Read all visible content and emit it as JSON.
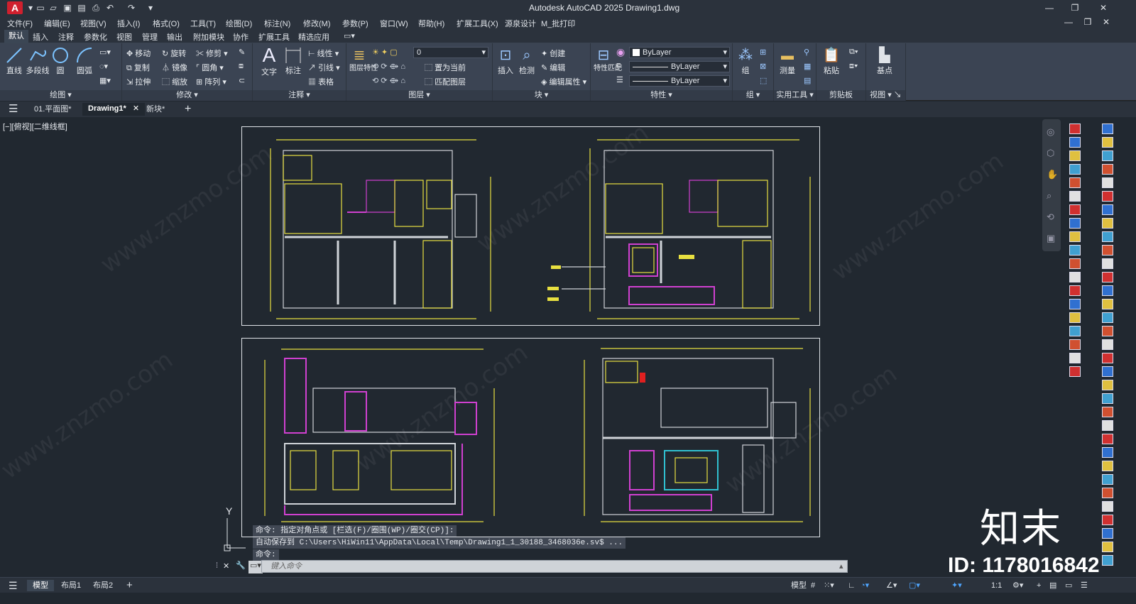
{
  "app": {
    "logo": "A",
    "title": "Autodesk AutoCAD 2025    Drawing1.dwg"
  },
  "menu": [
    "文件(F)",
    "编辑(E)",
    "视图(V)",
    "插入(I)",
    "格式(O)",
    "工具(T)",
    "绘图(D)",
    "标注(N)",
    "修改(M)",
    "参数(P)",
    "窗口(W)",
    "帮助(H)",
    "扩展工具(X)",
    "源泉设计",
    "M_批打印"
  ],
  "ribbon_tabs": [
    "默认",
    "插入",
    "注释",
    "参数化",
    "视图",
    "管理",
    "输出",
    "附加模块",
    "协作",
    "扩展工具",
    "精选应用"
  ],
  "ribbon": {
    "draw": {
      "title": "绘图",
      "line": "直线",
      "polyline": "多段线",
      "circle": "圆",
      "arc": "圆弧"
    },
    "modify": {
      "title": "修改",
      "move": "移动",
      "rotate": "旋转",
      "trim": "修剪",
      "copy": "复制",
      "mirror": "镜像",
      "fillet": "圆角",
      "stretch": "拉伸",
      "scale": "缩放",
      "array": "阵列"
    },
    "annotation": {
      "title": "注释",
      "text": "文字",
      "dimension": "标注",
      "linear": "线性",
      "leader": "引线",
      "table": "表格"
    },
    "layers": {
      "title": "图层",
      "props": "图层特性",
      "current_layer": "0",
      "make_current": "置为当前",
      "match_layer": "匹配图层"
    },
    "block": {
      "title": "块",
      "insert": "插入",
      "detect": "检测",
      "create": "创建",
      "edit": "编辑",
      "edit_attr": "编辑属性"
    },
    "properties": {
      "title": "特性",
      "match": "特性匹配",
      "color": "ByLayer",
      "linetype": "ByLayer",
      "lineweight": "ByLayer"
    },
    "groups": {
      "title": "组",
      "group": "组"
    },
    "utilities": {
      "title": "实用工具",
      "measure": "测量"
    },
    "clipboard": {
      "title": "剪贴板",
      "paste": "粘贴"
    },
    "view": {
      "title": "视图",
      "base": "基点"
    }
  },
  "file_tabs": [
    "01.平面图*",
    "Drawing1*",
    "新块*"
  ],
  "viewport_label": "[−][俯视][二维线框]",
  "ucs": {
    "y": "Y"
  },
  "command": {
    "history": [
      "命令: 指定对角点或 [栏选(F)/圈围(WP)/圈交(CP)]:",
      "自动保存到 C:\\Users\\HiWin11\\AppData\\Local\\Temp\\Drawing1_1_30188_3468036e.sv$ ...",
      "命令:"
    ],
    "placeholder": "键入命令"
  },
  "layout_tabs": [
    "模型",
    "布局1",
    "布局2"
  ],
  "status": {
    "model": "模型",
    "scale": "1:1"
  },
  "watermark": {
    "text": "www.znzmo.com",
    "logo": "知末",
    "id": "ID: 1178016842"
  }
}
